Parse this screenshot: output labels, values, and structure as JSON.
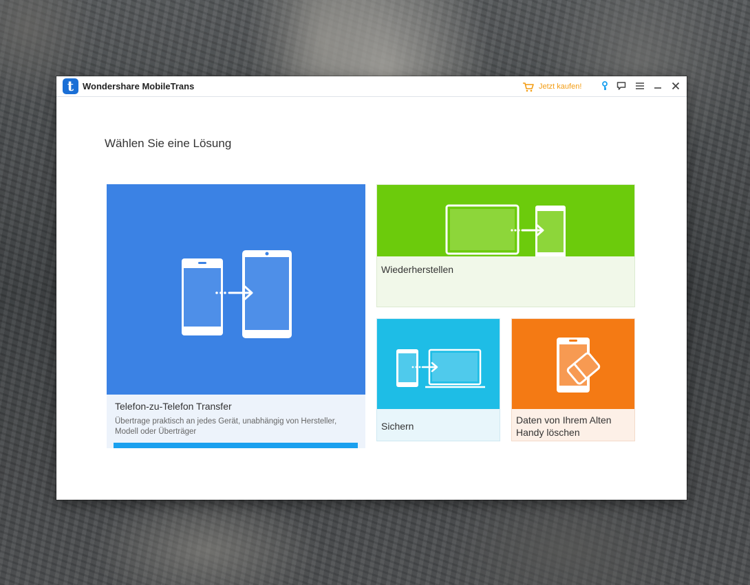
{
  "app": {
    "title": "Wondershare MobileTrans",
    "logo_letter": "t",
    "buy_label": "Jetzt kaufen!"
  },
  "titlebar_icons": [
    "cart-icon",
    "key-icon",
    "feedback-icon",
    "menu-icon",
    "minimize-icon",
    "close-icon"
  ],
  "main": {
    "heading": "Wählen Sie eine Lösung",
    "tiles": [
      {
        "title": "Telefon-zu-Telefon Transfer",
        "description": "Übertrage praktisch an jedes Gerät, unabhängig von Hersteller, Modell oder Überträger",
        "color": "#3b82e4"
      },
      {
        "title": "Wiederherstellen",
        "color": "#6ccb0c"
      },
      {
        "title": "Sichern",
        "color": "#1ebde6"
      },
      {
        "title": "Daten von Ihrem Alten Handy löschen",
        "color": "#f47a14"
      }
    ]
  },
  "colors": {
    "accent_buy": "#f39c12",
    "key_icon": "#1aa0ef",
    "progress_bar": "#1aa0ef"
  }
}
